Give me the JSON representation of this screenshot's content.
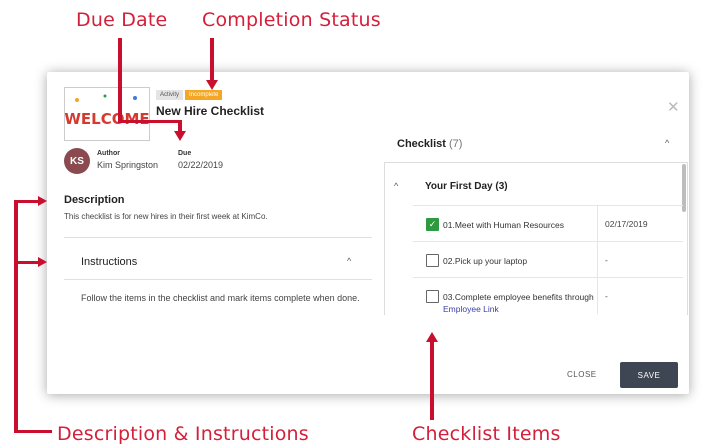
{
  "annotations": {
    "due_date": "Due Date",
    "completion_status": "Completion Status",
    "description_instructions": "Description & Instructions",
    "checklist_items": "Checklist Items"
  },
  "activity": {
    "type_badge": "Activity",
    "status_badge": "Incomplete",
    "title": "New Hire Checklist",
    "thumbnail_text": "WELCOME"
  },
  "author": {
    "initials": "KS",
    "label": "Author",
    "name": "Kim Springston"
  },
  "due": {
    "label": "Due",
    "date": "02/22/2019"
  },
  "description": {
    "heading": "Description",
    "text": "This checklist is for new hires in their first week at KimCo."
  },
  "instructions": {
    "heading": "Instructions",
    "text": "Follow the items in the checklist and mark items complete when done."
  },
  "checklist": {
    "heading": "Checklist",
    "count": "(7)",
    "section": "Your First Day  (3)",
    "items": [
      {
        "label": "01.Meet with Human Resources",
        "date": "02/17/2019"
      },
      {
        "label": "02.Pick up your laptop",
        "date": "-"
      },
      {
        "label": "03.Complete employee benefits through ",
        "link": "Employee Link",
        "date": "-"
      }
    ]
  },
  "footer": {
    "close_label": "CLOSE",
    "save_label": "SAVE"
  },
  "colors": {
    "annotation": "#d41f3a",
    "incomplete_badge": "#f5a623",
    "checked": "#2e9a3f",
    "save_button": "#3d4652",
    "avatar": "#8a4a4f"
  }
}
